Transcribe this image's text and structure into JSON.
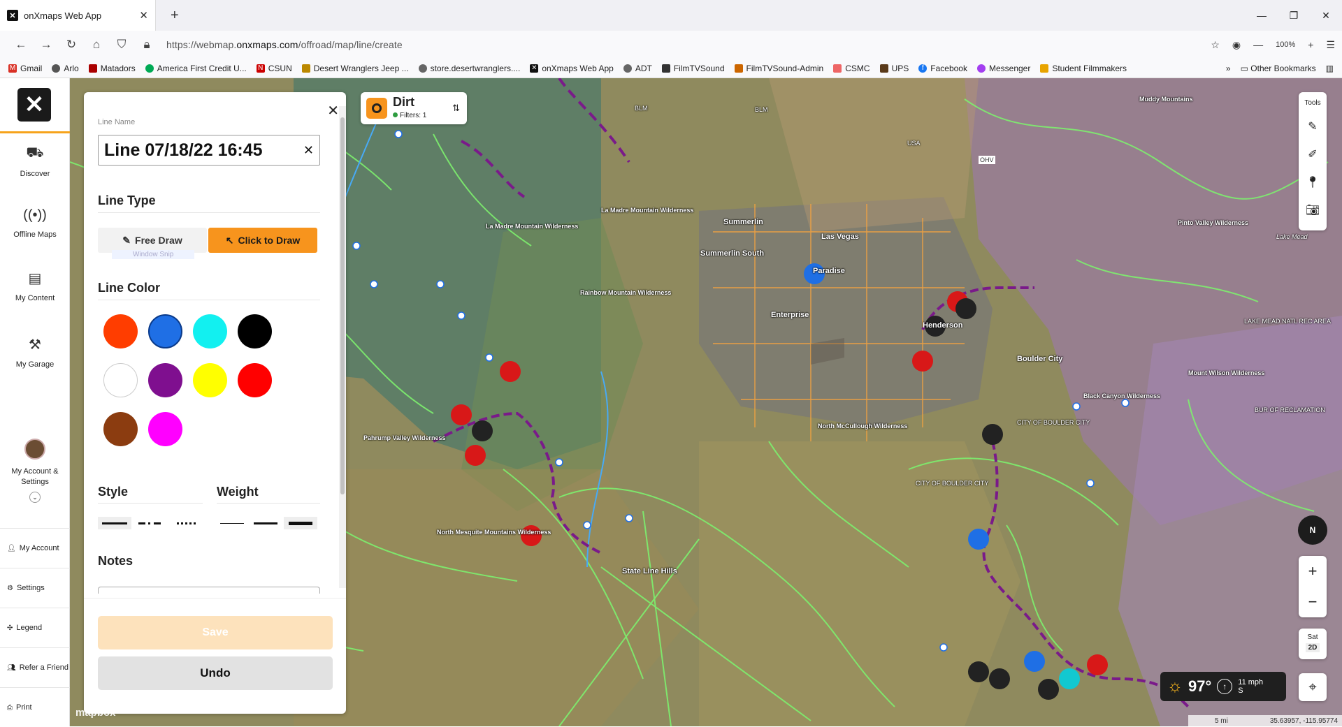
{
  "browser": {
    "tab_title": "onXmaps Web App",
    "url_prefix": "https://webmap.",
    "url_domain": "onxmaps.com",
    "url_path": "/offroad/map/line/create",
    "zoom": "100%",
    "bookmarks": [
      "Gmail",
      "Arlo",
      "Matadors",
      "America First Credit U...",
      "CSUN",
      "Desert Wranglers Jeep ...",
      "store.desertwranglers....",
      "onXmaps Web App",
      "ADT",
      "FilmTVSound",
      "FilmTVSound-Admin",
      "CSMC",
      "UPS",
      "Facebook",
      "Messenger",
      "Student Filmmakers"
    ],
    "other_bookmarks": "Other Bookmarks"
  },
  "nav": {
    "discover": "Discover",
    "offline": "Offline Maps",
    "content": "My Content",
    "garage": "My Garage",
    "account_settings": "My Account & Settings",
    "my_account": "My Account",
    "settings": "Settings",
    "legend": "Legend",
    "refer": "Refer a Friend",
    "print": "Print"
  },
  "panel": {
    "line_name_label": "Line Name",
    "line_name_value": "Line 07/18/22 16:45",
    "line_type_heading": "Line Type",
    "free_draw": "Free Draw",
    "click_to_draw": "Click to Draw",
    "tooltip": "Window Snip",
    "line_color_heading": "Line Color",
    "colors": [
      "#ff3d00",
      "#1f6fe5",
      "#12f0f0",
      "#000000",
      "#ffffff",
      "#7f0f8f",
      "#ffff00",
      "#ff0000",
      "#8b3c10",
      "#ff00ff"
    ],
    "style_heading": "Style",
    "weight_heading": "Weight",
    "notes_heading": "Notes",
    "save": "Save",
    "undo": "Undo"
  },
  "map": {
    "layer_title": "Dirt",
    "filters": "Filters: 1",
    "tools_label": "Tools",
    "compass": "N",
    "sat": "Sat",
    "view_2d": "2D",
    "temperature": "97°",
    "wind_speed": "11 mph",
    "wind_dir": "S",
    "scale": "5 mi",
    "coordinates": "35.63957, -115.95774",
    "attribution": "mapbox",
    "labels": {
      "summerlin": "Summerlin",
      "las_vegas": "Las Vegas",
      "summerlin_south": "Summerlin South",
      "paradise": "Paradise",
      "enterprise": "Enterprise",
      "henderson": "Henderson",
      "boulder_city": "Boulder City",
      "muddy": "Muddy Mountains",
      "pinto": "Pinto Valley Wilderness",
      "la_madre": "La Madre Mountain Wilderness",
      "la_madre2": "La Madre Mountain Wilderness",
      "rainbow": "Rainbow Mountain Wilderness",
      "pahrump": "Pahrump Valley Wilderness",
      "north_mcc": "North McCullough Wilderness",
      "north_mesq": "North Mesquite Mountains Wilderness",
      "state_line": "State Line Hills",
      "black_canyon": "Black Canyon Wilderness",
      "mount_wilson": "Mount Wilson Wilderness",
      "lake_mead_nra": "LAKE MEAD NATL REC AREA",
      "bur_rec": "BUR OF RECLAMATION",
      "city_boulder1": "CITY OF BOULDER CITY",
      "city_boulder2": "CITY OF BOULDER CITY",
      "lake_mead": "Lake Mead",
      "blm1": "BLM",
      "blm2": "BLM",
      "usa": "USA",
      "ohv": "OHV"
    }
  }
}
